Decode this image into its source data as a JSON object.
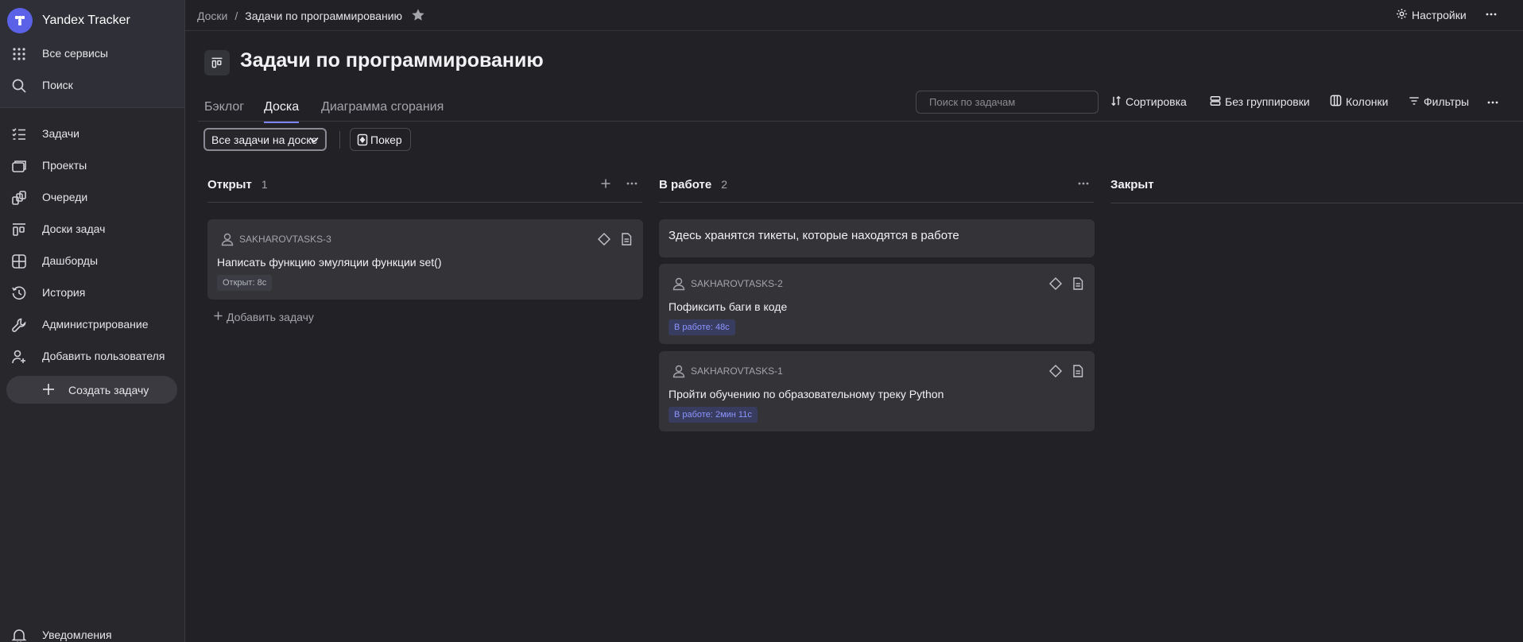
{
  "app": {
    "title": "Yandex Tracker"
  },
  "sidebar": {
    "all_services": "Все сервисы",
    "search": "Поиск",
    "items": [
      {
        "label": "Задачи",
        "icon": "tasks-icon"
      },
      {
        "label": "Проекты",
        "icon": "projects-icon"
      },
      {
        "label": "Очереди",
        "icon": "queues-icon"
      },
      {
        "label": "Доски задач",
        "icon": "boards-icon"
      },
      {
        "label": "Дашборды",
        "icon": "dashboards-icon"
      },
      {
        "label": "История",
        "icon": "history-icon"
      },
      {
        "label": "Администрирование",
        "icon": "wrench-icon"
      },
      {
        "label": "Добавить пользователя",
        "icon": "add-user-icon"
      }
    ],
    "create_task": "Создать задачу",
    "notifications": "Уведомления"
  },
  "header": {
    "breadcrumbs": {
      "root": "Доски",
      "current": "Задачи по программированию"
    },
    "settings_label": "Настройки"
  },
  "page": {
    "title": "Задачи по программированию",
    "tabs": [
      {
        "label": "Бэклог",
        "active": false
      },
      {
        "label": "Доска",
        "active": true
      },
      {
        "label": "Диаграмма сгорания",
        "active": false
      }
    ]
  },
  "toolbar": {
    "search_placeholder": "Поиск по задачам",
    "sort_label": "Сортировка",
    "grouping_label": "Без группировки",
    "columns_label": "Колонки",
    "filters_label": "Фильтры",
    "filter_select_value": "Все задачи на доске",
    "poker_label": "Покер"
  },
  "columns": [
    {
      "title": "Открыт",
      "count": "1",
      "add_task_label": "Добавить задачу",
      "cards": [
        {
          "key": "SAKHAROVTASKS-3",
          "summary": "Написать функцию эмуляции функции set()",
          "status": "Открыт: 8с"
        }
      ]
    },
    {
      "title": "В работе",
      "count": "2",
      "description": "Здесь хранятся тикеты, которые находятся в работе",
      "cards": [
        {
          "key": "SAKHAROVTASKS-2",
          "summary": "Пофиксить баги в коде",
          "status": "В работе: 48с"
        },
        {
          "key": "SAKHAROVTASKS-1",
          "summary": "Пройти обучению по образовательному треку Python",
          "status": "В работе: 2мин 11с"
        }
      ]
    },
    {
      "title": "Закрыт",
      "count": ""
    }
  ],
  "colors": {
    "background": "#222226",
    "sidebar": "#28282c",
    "accent": "#5b62e8",
    "card": "#333338",
    "status_work": "#8c96ff"
  }
}
